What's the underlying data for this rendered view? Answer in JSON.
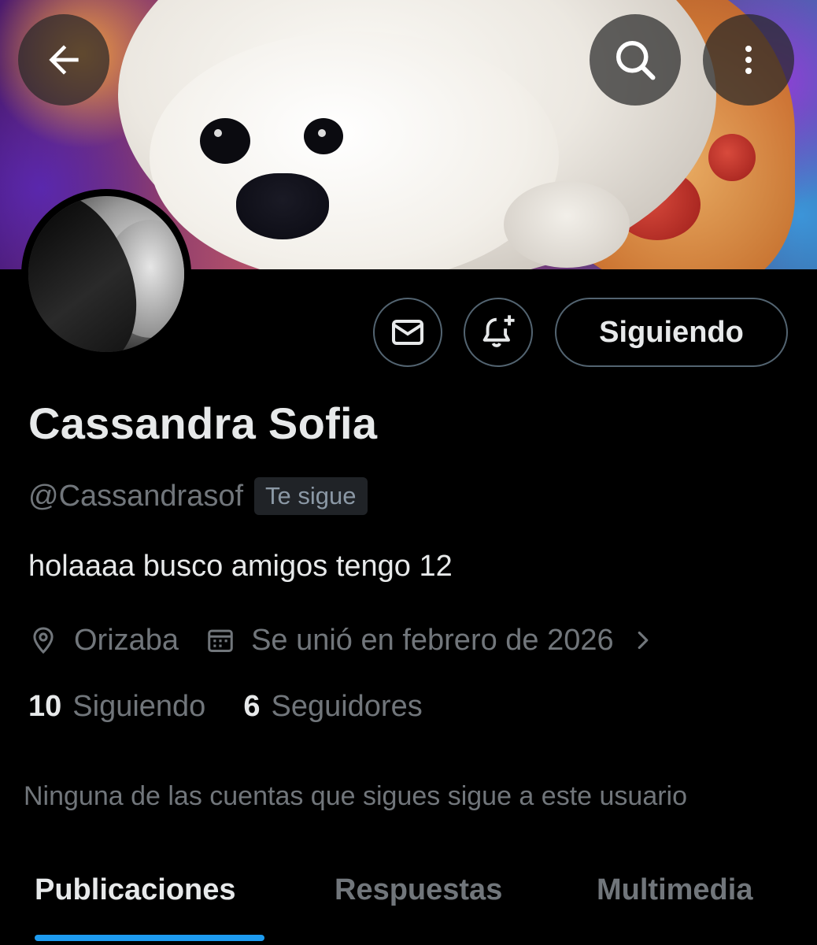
{
  "header": {
    "back_icon": "arrow-left-icon",
    "search_icon": "search-icon",
    "more_icon": "more-vertical-icon"
  },
  "profile": {
    "display_name": "Cassandra Sofia",
    "handle": "@Cassandrasof",
    "follows_you_badge": "Te sigue",
    "bio": "holaaaa busco amigos  tengo 12",
    "location": "Orizaba",
    "joined": "Se unió en febrero de 2026",
    "following_count": "10",
    "following_label": "Siguiendo",
    "followers_count": "6",
    "followers_label": "Seguidores",
    "mutuals_note": "Ninguna de las cuentas que sigues sigue a este usuario"
  },
  "actions": {
    "message_icon": "envelope-icon",
    "notify_icon": "bell-plus-icon",
    "follow_button_label": "Siguiendo"
  },
  "tabs": [
    {
      "label": "Publicaciones",
      "active": true
    },
    {
      "label": "Respuestas",
      "active": false
    },
    {
      "label": "Multimedia",
      "active": false
    }
  ],
  "colors": {
    "background": "#000000",
    "text_primary": "#e7e9ea",
    "text_secondary": "#71767b",
    "border": "#536471",
    "accent": "#1d9bf0"
  }
}
